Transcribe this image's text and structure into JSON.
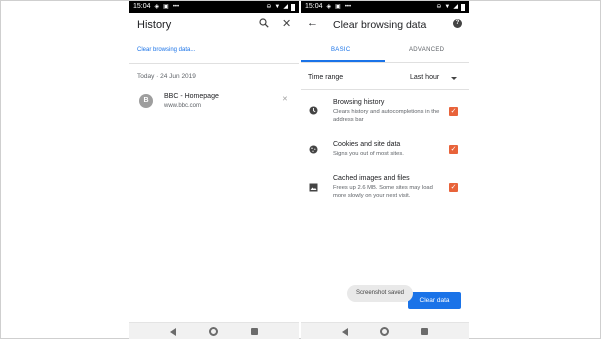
{
  "status_bar_left": {
    "time": "15:04"
  },
  "status_bar_right": {
    "time": "15:04"
  },
  "history": {
    "title": "History",
    "clear_link": "Clear browsing data...",
    "date_header": "Today · 24 Jun 2019",
    "items": [
      {
        "favicon_letter": "B",
        "title": "BBC - Homepage",
        "url": "www.bbc.com"
      }
    ]
  },
  "clear_data": {
    "title": "Clear browsing data",
    "tabs": [
      {
        "label": "BASIC",
        "active": true
      },
      {
        "label": "ADVANCED",
        "active": false
      }
    ],
    "time_range_label": "Time range",
    "time_range_value": "Last hour",
    "options": [
      {
        "title": "Browsing history",
        "description": "Clears history and autocompletions in the address bar",
        "checked": true,
        "icon": "clock-icon"
      },
      {
        "title": "Cookies and site data",
        "description": "Signs you out of most sites.",
        "checked": true,
        "icon": "cookie-icon"
      },
      {
        "title": "Cached images and files",
        "description": "Frees up 2.6 MB. Some sites may load more slowly on your next visit.",
        "checked": true,
        "icon": "image-icon"
      }
    ],
    "clear_button": "Clear data",
    "toast": "Screenshot saved"
  },
  "colors": {
    "accent": "#1a73e8",
    "checkbox": "#e8633a",
    "statusbar": "#000000"
  }
}
